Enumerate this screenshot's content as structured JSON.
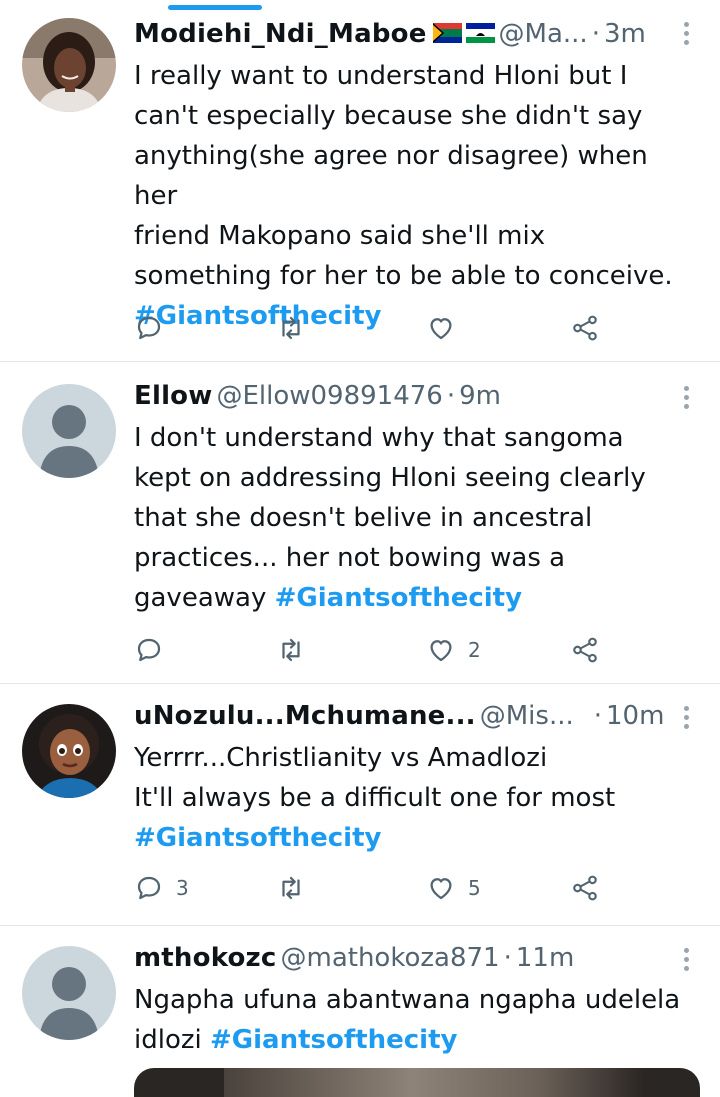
{
  "colors": {
    "accent": "#1d9bf0",
    "text": "#0f1419",
    "secondary": "#536471",
    "divider": "#e3e7ea"
  },
  "tweets": [
    {
      "name": "Modiehi_Ndi_Maboe",
      "flags": [
        "south-africa-flag",
        "lesotho-flag"
      ],
      "handle": "@Ma...",
      "dot": "·",
      "time": "3m",
      "text": "I really want to understand Hloni but I\ncan't especially because she didn't say\nanything(she agree nor disagree) when her\nfriend Makopano said she'll mix\nsomething for her to be able to conceive.\n",
      "hashtag": "#Giantsofthecity",
      "reply_count": "",
      "retweet_count": "",
      "like_count": "",
      "avatar": "photo-avatar"
    },
    {
      "name": "Ellow",
      "handle": "@Ellow09891476",
      "dot": "·",
      "time": "9m",
      "text": "I don't understand why that sangoma\nkept on addressing Hloni seeing clearly\nthat she doesn't belive in ancestral\npractices... her not bowing was a\ngaveaway ",
      "hashtag": "#Giantsofthecity",
      "reply_count": "",
      "retweet_count": "",
      "like_count": "2",
      "avatar": "default-avatar"
    },
    {
      "name": "uNozulu...Mchumane...",
      "handle": "@Mis...",
      "dot": "·",
      "time": "10m",
      "text": "Yerrrr...Christlianity vs Amadlozi\nIt'll always be a difficult one for most\n",
      "hashtag": "#Giantsofthecity",
      "reply_count": "3",
      "retweet_count": "",
      "like_count": "5",
      "avatar": "cartoon-avatar"
    },
    {
      "name": "mthokozc",
      "handle": "@mathokoza871",
      "dot": "·",
      "time": "11m",
      "text": "Ngapha ufuna abantwana ngapha udelela\nidlozi ",
      "hashtag": "#Giantsofthecity",
      "avatar": "default-avatar"
    }
  ]
}
